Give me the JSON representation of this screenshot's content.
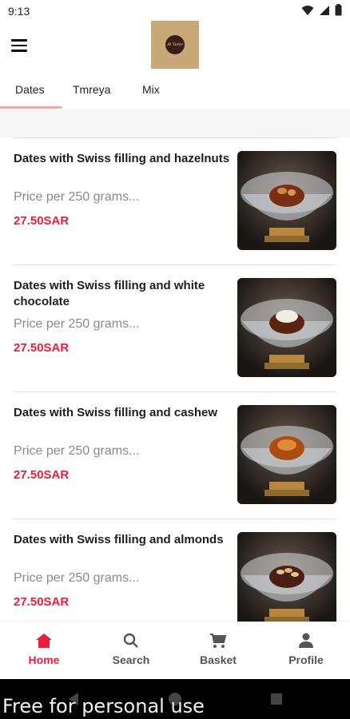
{
  "status": {
    "time": "9:13"
  },
  "tabs": [
    {
      "label": "Dates"
    },
    {
      "label": "Tmreya"
    },
    {
      "label": "Mix"
    }
  ],
  "logo": {
    "text": "Al Tamr"
  },
  "products": [
    {
      "title": "Dates with Swiss filling and hazelnuts",
      "description": "Price per 250 grams...",
      "price": "27.50SAR"
    },
    {
      "title": "Dates with Swiss filling and white chocolate",
      "description": "Price per 250 grams...",
      "price": "27.50SAR"
    },
    {
      "title": "Dates with Swiss filling and cashew",
      "description": "Price per 250 grams...",
      "price": "27.50SAR"
    },
    {
      "title": "Dates with Swiss filling and almonds",
      "description": "Price per 250 grams...",
      "price": "27.50SAR"
    }
  ],
  "bottom_nav": [
    {
      "label": "Home",
      "icon": "home-icon",
      "active": true
    },
    {
      "label": "Search",
      "icon": "search-icon",
      "active": false
    },
    {
      "label": "Basket",
      "icon": "cart-icon",
      "active": false
    },
    {
      "label": "Profile",
      "icon": "person-icon",
      "active": false
    }
  ],
  "watermark": "Free for personal use",
  "colors": {
    "accent": "#ec1c3a",
    "tab_indicator": "#f0a7a7",
    "logo_bg": "#c9a878"
  }
}
